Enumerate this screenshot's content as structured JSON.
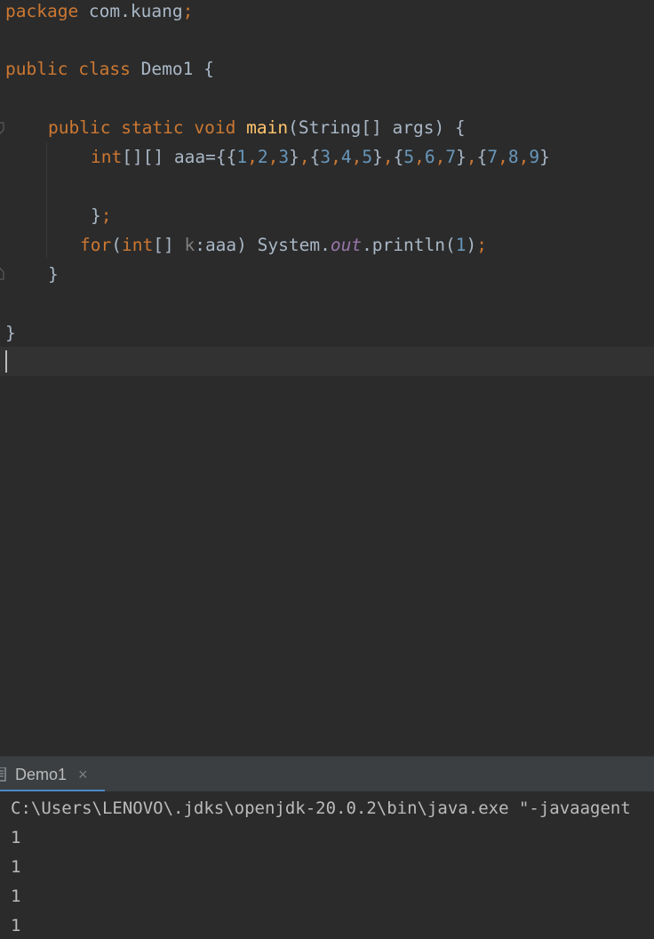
{
  "editor": {
    "line1": {
      "kw": "package",
      "text": " com.kuang",
      "semi": ";"
    },
    "line3": {
      "kw1": "public",
      "kw2": "class",
      "name": " Demo1 {"
    },
    "line5": {
      "kw1": "public",
      "kw2": "static",
      "kw3": "void",
      "fn": "main",
      "rest": "(String[] args) {"
    },
    "line6": {
      "kw": "int",
      "pre": "[][] aaa={{",
      "n1": "1",
      "n2": "2",
      "n3": "3",
      "n4": "3",
      "n5": "4",
      "n6": "5",
      "n7": "5",
      "n8": "6",
      "n9": "7",
      "n10": "7",
      "n11": "8",
      "n12": "9"
    },
    "line8": {
      "brace": "}",
      "semi": ";"
    },
    "line9": {
      "kw1": "for",
      "paren": "(",
      "kw2": "int",
      "arr": "[] ",
      "var": "k",
      "mid": ":aaa) System.",
      "fld": "out",
      "call": ".println(",
      "num": "1",
      "end": ")",
      "semi": ";"
    },
    "line10": {
      "brace": "}"
    },
    "line12": {
      "brace": "}"
    }
  },
  "run_panel": {
    "tab_label": "Demo1",
    "close_glyph": "×"
  },
  "console": {
    "command": "C:\\Users\\LENOVO\\.jdks\\openjdk-20.0.2\\bin\\java.exe \"-javaagent",
    "outputs": [
      "1",
      "1",
      "1",
      "1"
    ]
  }
}
